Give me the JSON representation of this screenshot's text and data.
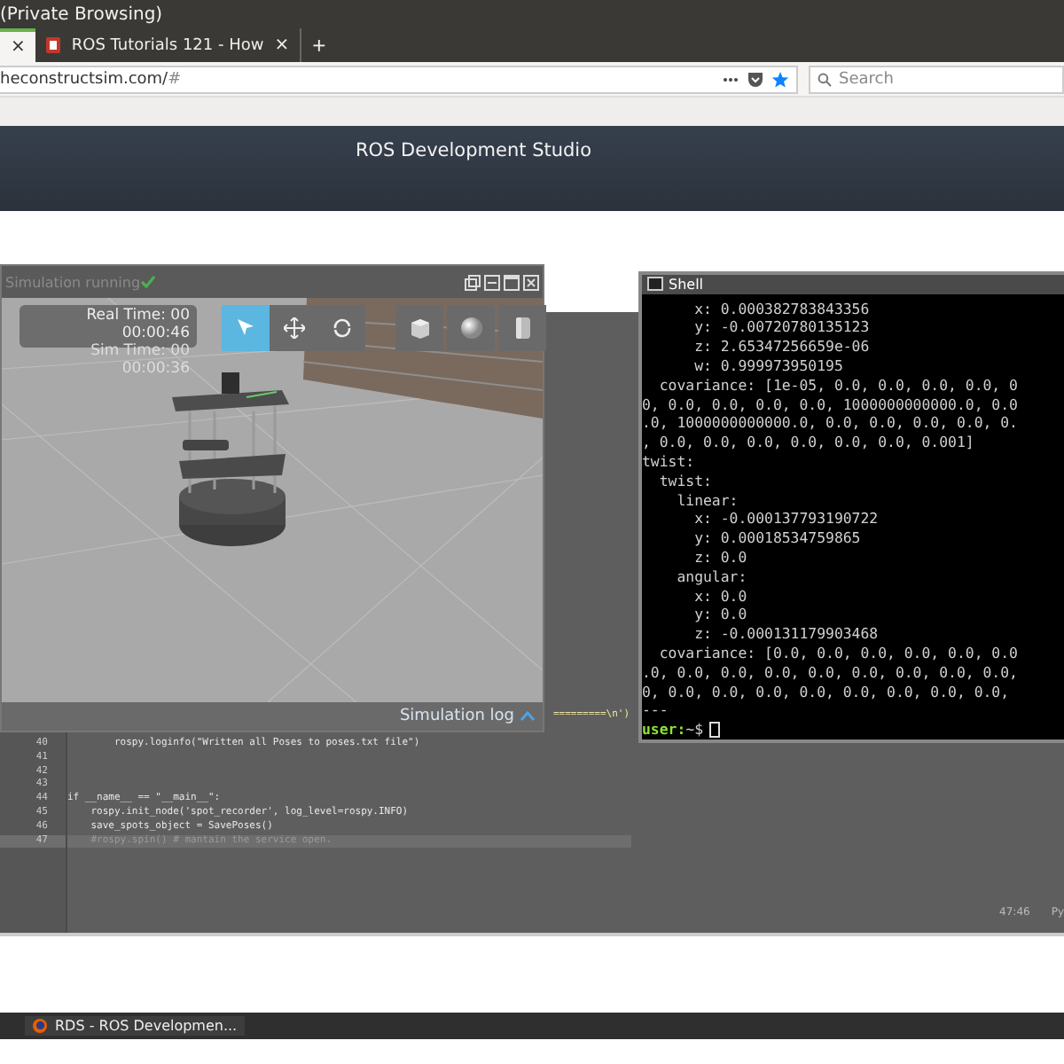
{
  "browser": {
    "window_title": "(Private Browsing)",
    "tabs": [
      {
        "close": "×",
        "selected": true
      },
      {
        "label": "ROS Tutorials 121 - How",
        "close": "×",
        "selected": false
      }
    ],
    "new_tab": "+",
    "url": "heconstructsim.com/",
    "url_hash": "#",
    "search": {
      "placeholder": "Search"
    }
  },
  "app_header": {
    "title": "ROS Development Studio"
  },
  "simulation": {
    "status": "Simulation running",
    "real_time_label": "Real Time: 00",
    "real_time": "00:00:46",
    "sim_time_label": "Sim Time: 00",
    "sim_time": "00:00:36",
    "tools": [
      {
        "kind": "select",
        "selected": true
      },
      {
        "kind": "move",
        "selected": false
      },
      {
        "kind": "rotate",
        "selected": false
      },
      {
        "kind": "box",
        "selected": false
      },
      {
        "kind": "sphere",
        "selected": false
      },
      {
        "kind": "cylinder",
        "selected": false
      }
    ],
    "log_button": "Simulation log"
  },
  "shell": {
    "title": "Shell",
    "lines": [
      "      x: 0.000382783843356",
      "      y: -0.00720780135123",
      "      z: 2.65347256659e-06",
      "      w: 0.999973950195",
      "  covariance: [1e-05, 0.0, 0.0, 0.0, 0.0, 0",
      "0, 0.0, 0.0, 0.0, 0.0, 1000000000000.0, 0.0",
      ".0, 1000000000000.0, 0.0, 0.0, 0.0, 0.0, 0.",
      ", 0.0, 0.0, 0.0, 0.0, 0.0, 0.0, 0.001]",
      "twist:",
      "  twist:",
      "    linear:",
      "      x: -0.000137793190722",
      "      y: 0.00018534759865",
      "      z: 0.0",
      "    angular:",
      "      x: 0.0",
      "      y: 0.0",
      "      z: -0.000131179903468",
      "  covariance: [0.0, 0.0, 0.0, 0.0, 0.0, 0.0",
      ".0, 0.0, 0.0, 0.0, 0.0, 0.0, 0.0, 0.0, 0.0,",
      "0, 0.0, 0.0, 0.0, 0.0, 0.0, 0.0, 0.0, 0.0,",
      "---"
    ],
    "prompt_user": "user:",
    "prompt_path": "~$"
  },
  "editor": {
    "hidden_fragment": "=========\\n')",
    "lines": [
      {
        "number": "40",
        "code": "        rospy.loginfo(\"Written all Poses to poses.txt file\")",
        "kind": "code",
        "selected": false
      },
      {
        "number": "41",
        "kind": "code",
        "selected": false
      },
      {
        "number": "42",
        "kind": "code",
        "selected": false
      },
      {
        "number": "43",
        "kind": "code",
        "selected": false
      },
      {
        "number": "44",
        "code": "if __name__ == \"__main__\":",
        "kind": "code",
        "selected": false
      },
      {
        "number": "45",
        "code": "    rospy.init_node('spot_recorder', log_level=rospy.INFO)",
        "kind": "code",
        "selected": false
      },
      {
        "number": "46",
        "code": "    save_spots_object = SavePoses()",
        "kind": "code",
        "selected": false
      },
      {
        "number": "47",
        "code": "    #rospy.spin() # mantain the service open.",
        "kind": "comment",
        "selected": true
      }
    ],
    "cursor_position": "47:46",
    "language": "Py"
  },
  "taskbar": [
    {
      "label": "RDS - ROS Developmen..."
    }
  ]
}
